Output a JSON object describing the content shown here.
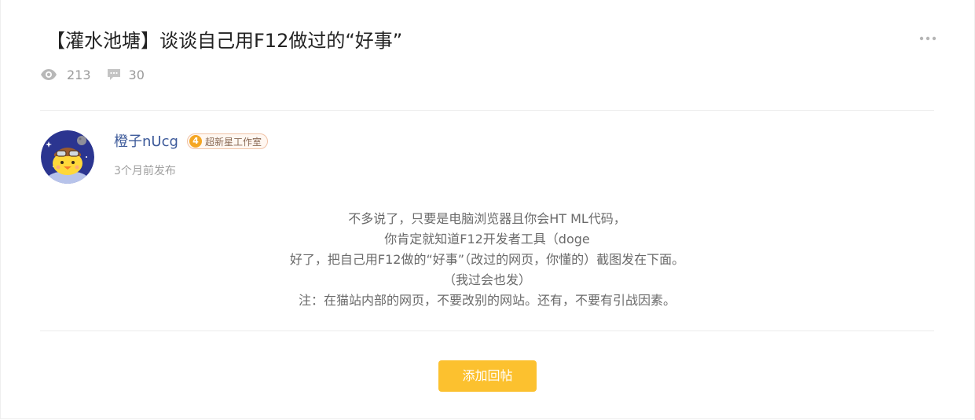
{
  "post": {
    "title": "【灌水池塘】谈谈自己用F12做过的“好事”",
    "more_icon": "more-dots-icon",
    "stats": {
      "views_icon": "eye-icon",
      "views": "213",
      "comments_icon": "comment-icon",
      "comments": "30"
    },
    "author": {
      "name": "橙子nUcg",
      "avatar_icon": "avatar-chick-pilot",
      "badge_level": "4",
      "badge_label": "超新星工作室",
      "posted_time": "3个月前发布"
    },
    "content_lines": [
      "不多说了，只要是电脑浏览器且你会HT ML代码，",
      "你肯定就知道F12开发者工具（doge",
      "好了，把自己用F12做的“好事”（改过的网页，你懂的）截图发在下面。",
      "（我过会也发）",
      "注：在猫站内部的网页，不要改别的网站。还有，不要有引战因素。"
    ],
    "reply_button": "添加回帖"
  },
  "colors": {
    "author_name": "#3d5a9a",
    "reply_button": "#fcc12f",
    "badge_level": "#f5a623",
    "muted_text": "#9a9a9a"
  }
}
